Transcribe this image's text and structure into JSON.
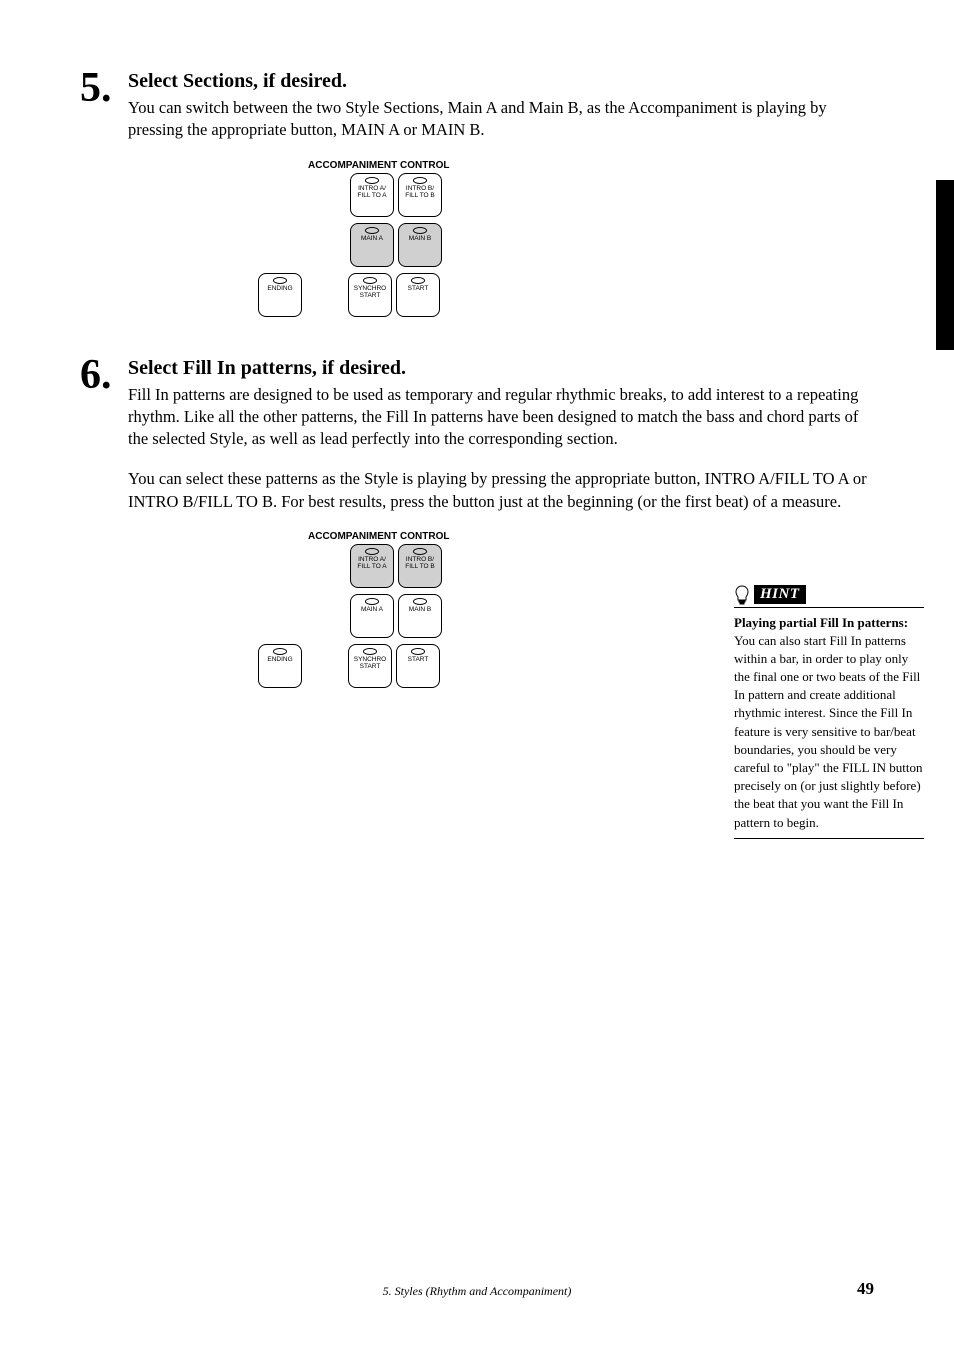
{
  "step5": {
    "number": "5",
    "dot": ".",
    "title": "Select Sections, if desired.",
    "body": "You can switch between the two Style Sections, Main A and Main B, as the Accompaniment is playing by pressing the appropriate button, MAIN A or MAIN B."
  },
  "step6": {
    "number": "6",
    "dot": ".",
    "title": "Select Fill In patterns, if desired.",
    "body1": "Fill In patterns are designed to be used as temporary and regular rhythmic breaks, to add interest to a repeating rhythm.  Like all the other patterns, the Fill In patterns have been designed to match the bass and chord parts of the selected Style, as well as lead perfectly into the corresponding section.",
    "body2": "You can select these patterns as the Style is playing by pressing the appropriate button, INTRO A/FILL TO A or INTRO B/FILL TO B.  For best results, press the button just at the beginning (or the first beat) of a measure."
  },
  "panel": {
    "title": "ACCOMPANIMENT CONTROL",
    "introA": "INTRO A/\nFILL TO A",
    "introB": "INTRO B/\nFILL TO B",
    "mainA": "MAIN A",
    "mainB": "MAIN B",
    "ending": "ENDING",
    "synchro": "SYNCHRO\nSTART",
    "start": "START"
  },
  "hint": {
    "tag": "HINT",
    "title": "Playing partial Fill In patterns:",
    "text": "You can also start Fill In patterns within a bar, in order to play only the final one or two beats of the Fill In pattern and create additional rhythmic interest. Since the Fill In feature is very sensitive to bar/beat boundaries, you should be very careful to \"play\" the FILL IN button precisely on (or just slightly before) the beat that you want the Fill In pattern to begin."
  },
  "footer": {
    "chapter": "5.",
    "title": "Styles (Rhythm and Accompaniment)",
    "page": "49"
  }
}
